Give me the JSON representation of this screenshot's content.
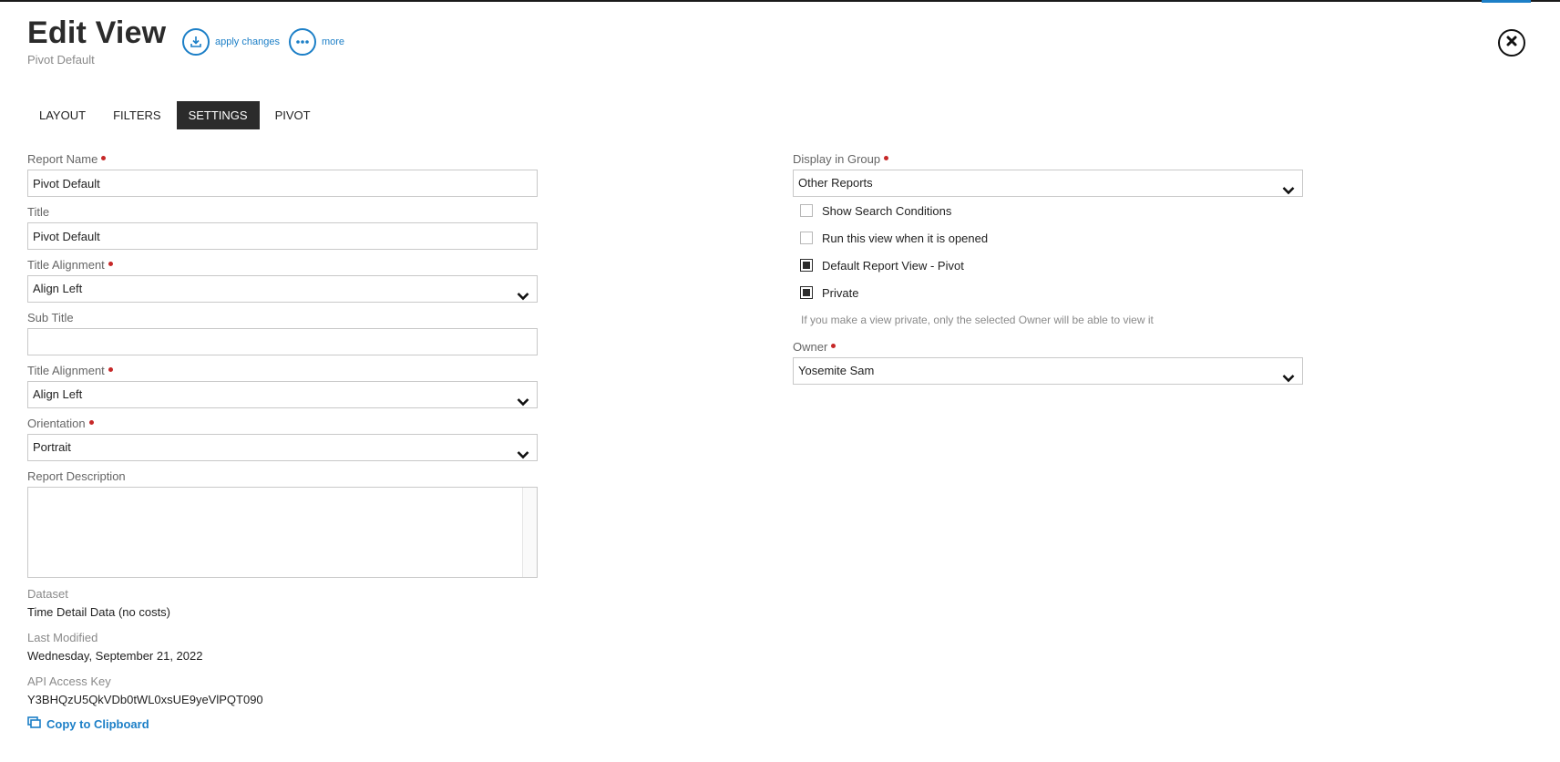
{
  "header": {
    "title": "Edit View",
    "subtitle": "Pivot Default",
    "actions": [
      {
        "label": "apply changes",
        "icon": "download-icon"
      },
      {
        "label": "more",
        "icon": "ellipsis-icon"
      }
    ],
    "close_icon": "close-icon"
  },
  "tabs": [
    {
      "label": "LAYOUT",
      "active": false
    },
    {
      "label": "FILTERS",
      "active": false
    },
    {
      "label": "SETTINGS",
      "active": true
    },
    {
      "label": "PIVOT",
      "active": false
    }
  ],
  "left": {
    "report_name": {
      "label": "Report Name",
      "value": "Pivot Default",
      "required": true
    },
    "title": {
      "label": "Title",
      "value": "Pivot Default"
    },
    "title_alignment": {
      "label": "Title Alignment",
      "value": "Align Left",
      "required": true
    },
    "sub_title": {
      "label": "Sub Title",
      "value": ""
    },
    "sub_title_alignment": {
      "label": "Title Alignment",
      "value": "Align Left",
      "required": true
    },
    "orientation": {
      "label": "Orientation",
      "value": "Portrait",
      "required": true
    },
    "report_description": {
      "label": "Report Description",
      "value": ""
    },
    "dataset": {
      "label": "Dataset",
      "value": "Time Detail Data (no costs)"
    },
    "last_modified": {
      "label": "Last Modified",
      "value": "Wednesday, September 21, 2022"
    },
    "api_access_key": {
      "label": "API Access Key",
      "value": "Y3BHQzU5QkVDb0tWL0xsUE9yeVlPQT090"
    },
    "copy_label": "Copy to Clipboard"
  },
  "right": {
    "display_in_group": {
      "label": "Display in Group",
      "value": "Other Reports",
      "required": true
    },
    "checkboxes": [
      {
        "label": "Show Search Conditions",
        "checked": false
      },
      {
        "label": "Run this view when it is opened",
        "checked": false
      },
      {
        "label": "Default Report View - Pivot",
        "checked": true
      },
      {
        "label": "Private",
        "checked": true
      }
    ],
    "private_help": "If you make a view private, only the selected Owner will be able to view it",
    "owner": {
      "label": "Owner",
      "value": "Yosemite Sam",
      "required": true
    }
  },
  "colors": {
    "accent": "#1c7fc7",
    "required": "#c62828",
    "dark": "#2b2b2b"
  }
}
